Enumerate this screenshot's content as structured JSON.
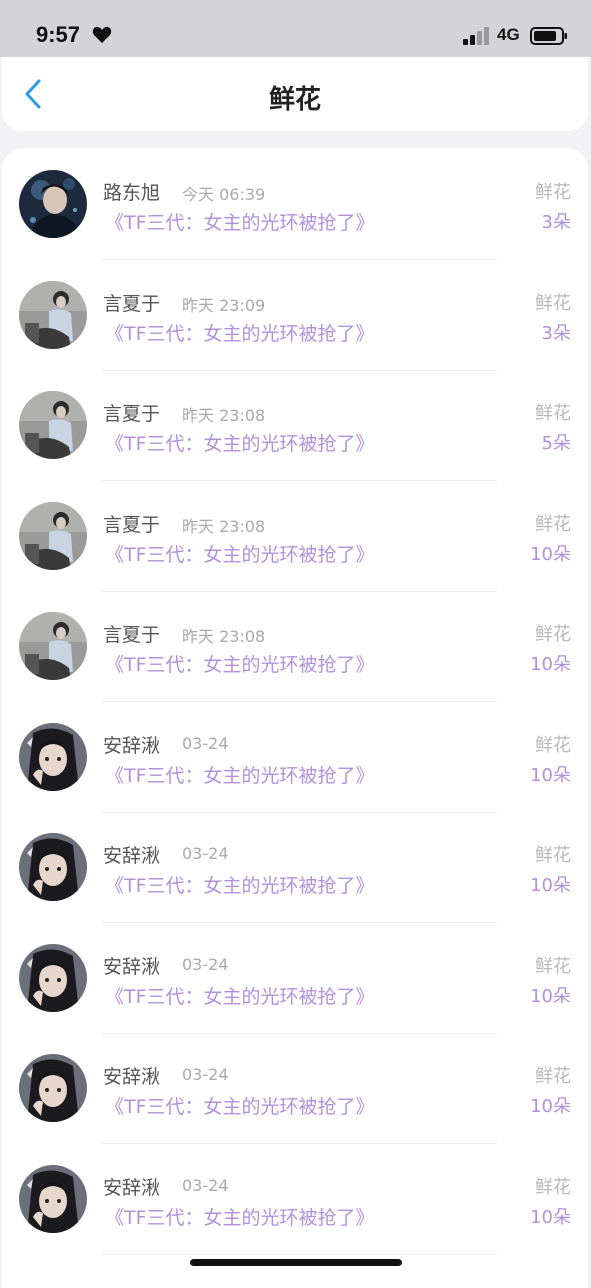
{
  "status_bar": {
    "time": "9:57",
    "network": "4G"
  },
  "nav": {
    "title": "鲜花"
  },
  "items": [
    {
      "name": "路东旭",
      "time": "今天 06:39",
      "book": "《TF三代：女主的光环被抢了》",
      "type": "鲜花",
      "count": "3朵",
      "avatar": "avatar-dark"
    },
    {
      "name": "言夏于",
      "time": "昨天 23:09",
      "book": "《TF三代：女主的光环被抢了》",
      "type": "鲜花",
      "count": "3朵",
      "avatar": "avatar-gray"
    },
    {
      "name": "言夏于",
      "time": "昨天 23:08",
      "book": "《TF三代：女主的光环被抢了》",
      "type": "鲜花",
      "count": "5朵",
      "avatar": "avatar-gray"
    },
    {
      "name": "言夏于",
      "time": "昨天 23:08",
      "book": "《TF三代：女主的光环被抢了》",
      "type": "鲜花",
      "count": "10朵",
      "avatar": "avatar-gray"
    },
    {
      "name": "言夏于",
      "time": "昨天 23:08",
      "book": "《TF三代：女主的光环被抢了》",
      "type": "鲜花",
      "count": "10朵",
      "avatar": "avatar-gray"
    },
    {
      "name": "安辞湫",
      "time": "03-24",
      "book": "《TF三代：女主的光环被抢了》",
      "type": "鲜花",
      "count": "10朵",
      "avatar": "avatar-girl"
    },
    {
      "name": "安辞湫",
      "time": "03-24",
      "book": "《TF三代：女主的光环被抢了》",
      "type": "鲜花",
      "count": "10朵",
      "avatar": "avatar-girl"
    },
    {
      "name": "安辞湫",
      "time": "03-24",
      "book": "《TF三代：女主的光环被抢了》",
      "type": "鲜花",
      "count": "10朵",
      "avatar": "avatar-girl"
    },
    {
      "name": "安辞湫",
      "time": "03-24",
      "book": "《TF三代：女主的光环被抢了》",
      "type": "鲜花",
      "count": "10朵",
      "avatar": "avatar-girl"
    },
    {
      "name": "安辞湫",
      "time": "03-24",
      "book": "《TF三代：女主的光环被抢了》",
      "type": "鲜花",
      "count": "10朵",
      "avatar": "avatar-girl"
    }
  ],
  "colors": {
    "accent": "#b191dc",
    "back_arrow": "#2a9ee8"
  }
}
